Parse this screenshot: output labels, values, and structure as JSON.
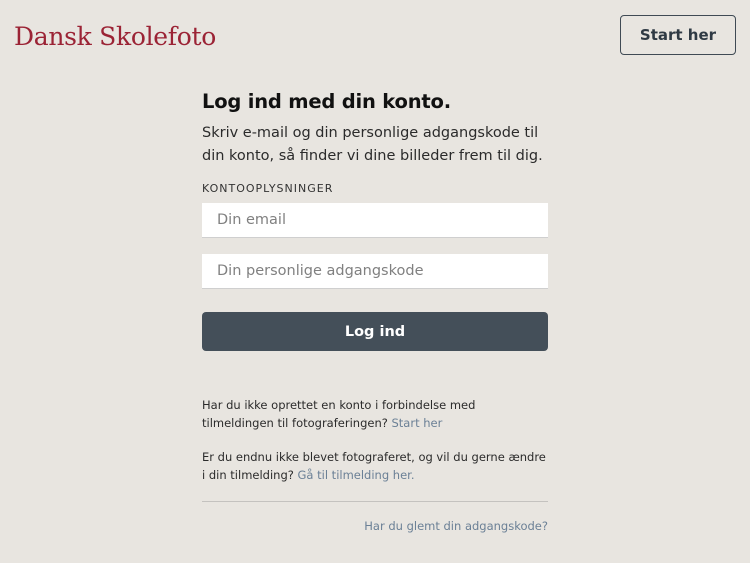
{
  "header": {
    "logo": "Dansk Skolefoto",
    "start_button": "Start her"
  },
  "login": {
    "title": "Log ind med din konto.",
    "subtitle": "Skriv e-mail og din personlige adgangskode til din konto, så finder vi dine billeder frem til dig.",
    "section_label": "KONTOOPLYSNINGER",
    "email_placeholder": "Din email",
    "email_value": "",
    "password_placeholder": "Din personlige adgangskode",
    "password_value": "",
    "submit_label": "Log ind"
  },
  "info": {
    "no_account_text": "Har du ikke oprettet en konto i forbindelse med tilmeldingen til fotograferingen? ",
    "no_account_link": "Start her",
    "change_text": "Er du endnu ikke blevet fotograferet, og vil du gerne ændre i din tilmelding? ",
    "change_link": "Gå til tilmelding her.",
    "forgot_link": "Har du glemt din adgangskode?"
  },
  "colors": {
    "background": "#e8e5e0",
    "brand": "#9b2335",
    "button": "#444f59",
    "link": "#6b8096"
  }
}
